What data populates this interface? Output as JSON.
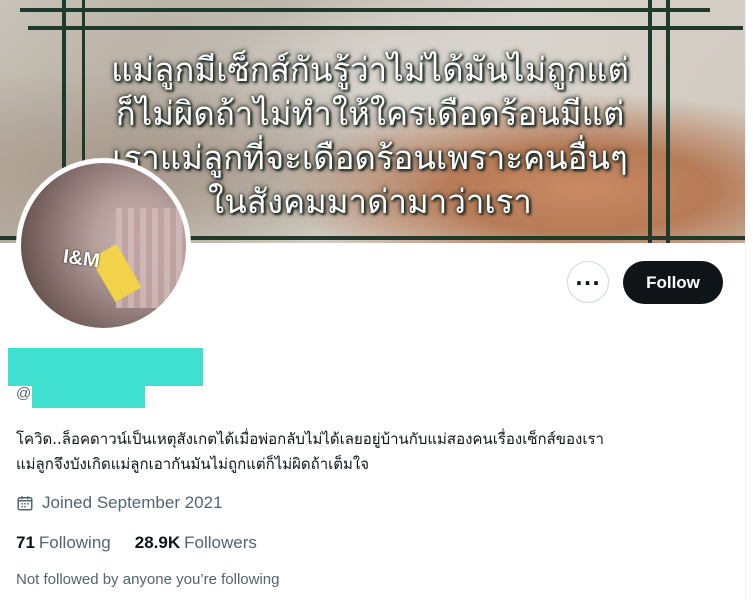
{
  "banner": {
    "text_lines": [
      "แม่ลูกมีเซ็กส์กันรู้ว่าไม่ได้มันไม่ถูกแต่",
      "ก็ไม่ผิดถ้าไม่ทำให้ใครเดือดร้อนมีแต่",
      "เราแม่ลูกที่จะเดือดร้อนเพราะคนอื่นๆ",
      "ในสังคมมาด่ามาว่าเรา"
    ]
  },
  "avatar": {
    "label": "I&M"
  },
  "actions": {
    "more_label": "...",
    "follow_label": "Follow"
  },
  "profile": {
    "handle_prefix": "@",
    "bio_lines": [
      "โควิด..ล็อคดาวน์เป็นเหตุสังเกตได้เมื่อพ่อกลับไม่ได้เลยอยู่บ้านกับแม่สองคนเรื่องเซ็กส์ของเรา",
      "แม่ลูกจึงบังเกิดแม่ลูกเอากันมันไม่ถูกแต่ก็ไม่ผิดถ้าเต็มใจ"
    ],
    "joined": "Joined September 2021",
    "following_count": "71",
    "following_label": "Following",
    "followers_count": "28.9K",
    "followers_label": "Followers",
    "not_followed": "Not followed by anyone you’re following"
  },
  "colors": {
    "redaction": "#40e0d0",
    "follow_bg": "#0f1419",
    "frame": "#1f3a2c"
  }
}
